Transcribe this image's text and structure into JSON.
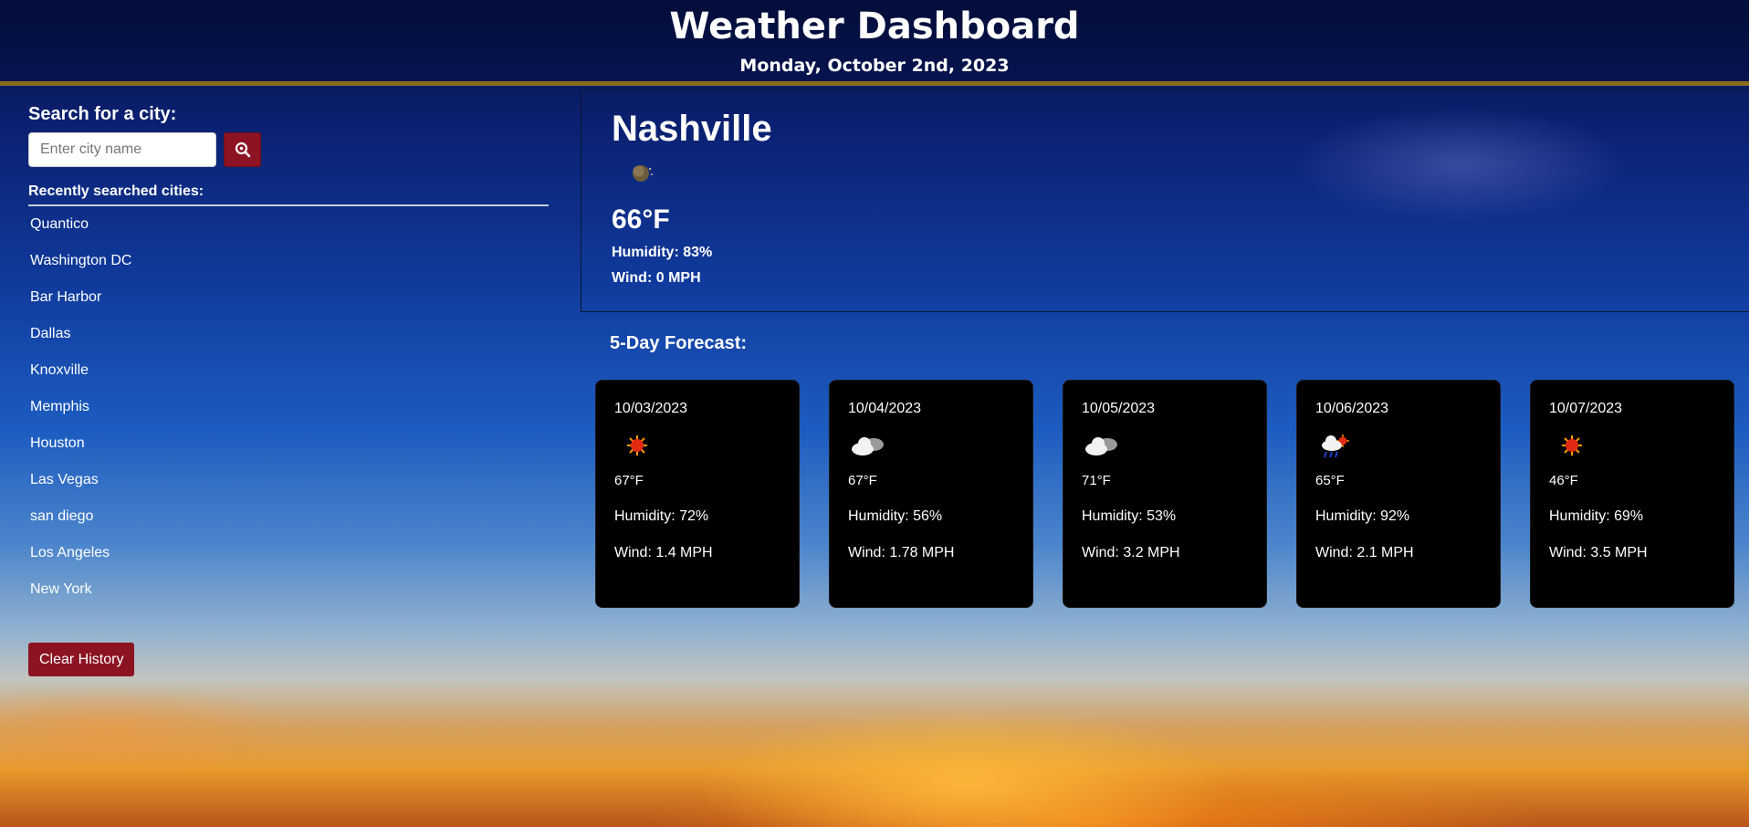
{
  "header": {
    "title": "Weather Dashboard",
    "date": "Monday, October 2nd, 2023"
  },
  "search": {
    "label": "Search for a city:",
    "placeholder": "Enter city name",
    "button_icon": "search-icon"
  },
  "recent": {
    "label": "Recently searched cities:",
    "cities": [
      "Quantico",
      "Washington DC",
      "Bar Harbor",
      "Dallas",
      "Knoxville",
      "Memphis",
      "Houston",
      "Las Vegas",
      "san diego",
      "Los Angeles",
      "New York"
    ]
  },
  "clear_label": "Clear History",
  "current": {
    "city": "Nashville",
    "icon": "moon-clear-night-icon",
    "temp": "66°F",
    "humidity": "Humidity: 83%",
    "wind": "Wind: 0 MPH"
  },
  "forecast": {
    "title": "5-Day Forecast:",
    "days": [
      {
        "date": "10/03/2023",
        "icon": "sun-icon",
        "temp": "67°F",
        "humidity": "Humidity: 72%",
        "wind": "Wind: 1.4 MPH"
      },
      {
        "date": "10/04/2023",
        "icon": "cloud-icon",
        "temp": "67°F",
        "humidity": "Humidity: 56%",
        "wind": "Wind: 1.78 MPH"
      },
      {
        "date": "10/05/2023",
        "icon": "cloud-icon",
        "temp": "71°F",
        "humidity": "Humidity: 53%",
        "wind": "Wind: 3.2 MPH"
      },
      {
        "date": "10/06/2023",
        "icon": "rain-sun-icon",
        "temp": "65°F",
        "humidity": "Humidity: 92%",
        "wind": "Wind: 2.1 MPH"
      },
      {
        "date": "10/07/2023",
        "icon": "sun-icon",
        "temp": "46°F",
        "humidity": "Humidity: 69%",
        "wind": "Wind: 3.5 MPH"
      }
    ]
  },
  "colors": {
    "accent": "#8b1322",
    "header_rule": "#8a6b1f",
    "card_bg": "#000000"
  }
}
